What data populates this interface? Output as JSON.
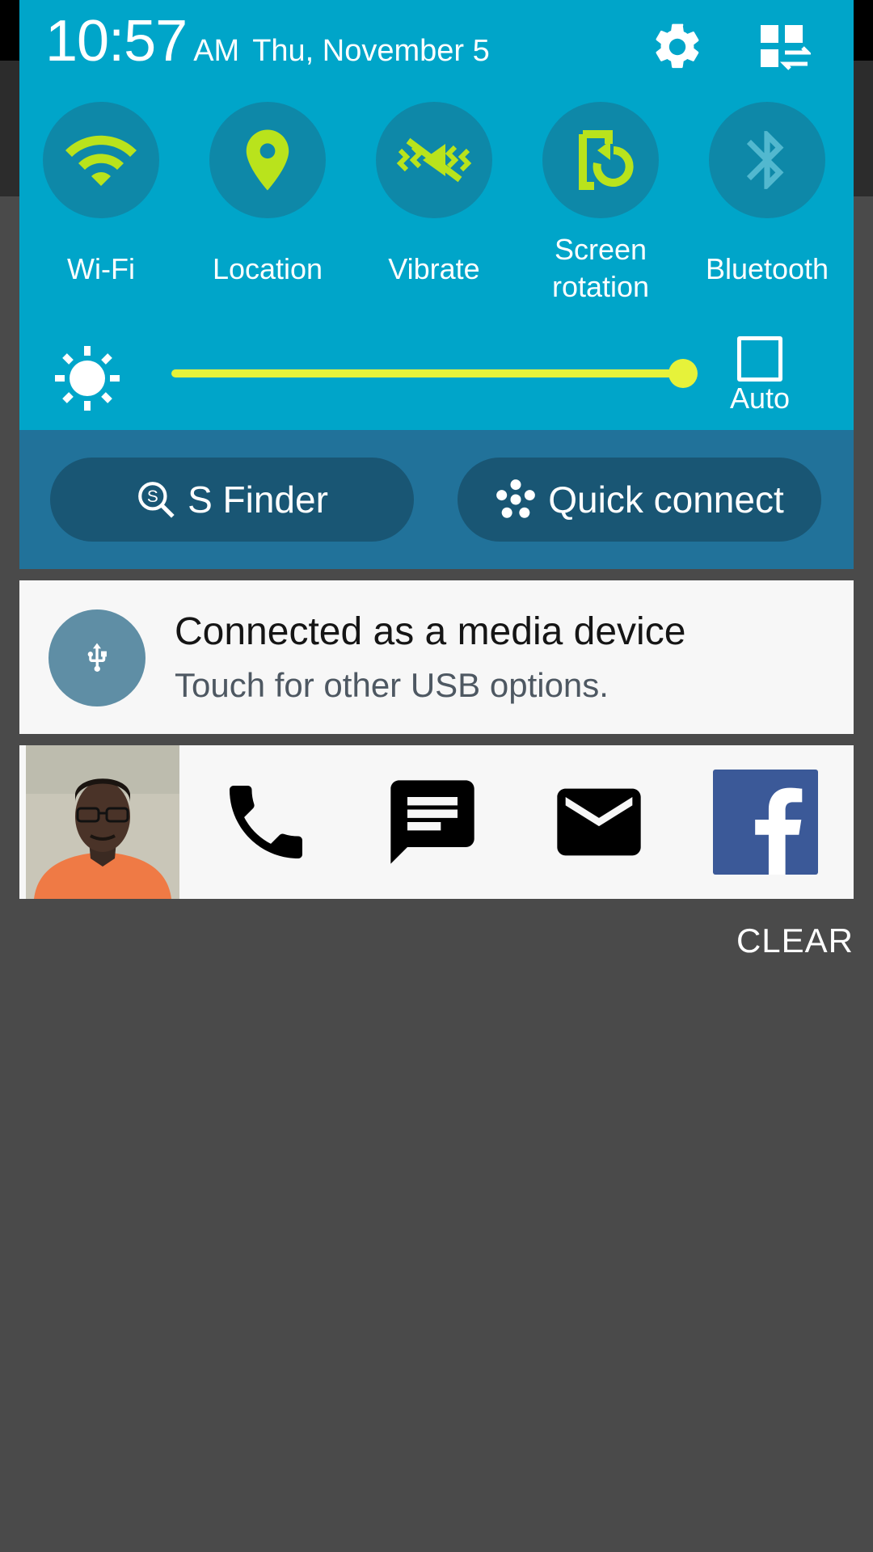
{
  "header": {
    "time": "10:57",
    "ampm": "AM",
    "date": "Thu, November 5",
    "settings_icon": "gear-icon",
    "edit_icon": "edit-toggles-icon"
  },
  "toggles": [
    {
      "label": "Wi-Fi",
      "icon": "wifi-icon",
      "active": true
    },
    {
      "label": "Location",
      "icon": "location-pin-icon",
      "active": true
    },
    {
      "label": "Vibrate",
      "icon": "vibrate-icon",
      "active": true
    },
    {
      "label_line1": "Screen",
      "label_line2": "rotation",
      "icon": "screen-rotation-icon",
      "active": true
    },
    {
      "label": "Bluetooth",
      "icon": "bluetooth-icon",
      "active": false
    }
  ],
  "brightness": {
    "level_percent": 100,
    "auto_label": "Auto",
    "auto_checked": false
  },
  "quick_buttons": {
    "s_finder": "S Finder",
    "quick_connect": "Quick connect"
  },
  "usb_notification": {
    "title": "Connected as a media device",
    "subtitle": "Touch for other USB options.",
    "icon": "usb-icon"
  },
  "contact_notification": {
    "actions": [
      "phone-icon",
      "message-icon",
      "email-icon",
      "facebook-icon"
    ]
  },
  "clear_label": "CLEAR",
  "colors": {
    "panel": "#00a5c9",
    "toggle_circle": "#0e88a8",
    "active_icon": "#b9e31c",
    "inactive_icon": "#52b8cf",
    "slider": "#e6f23a",
    "button_bar": "#21729a",
    "pill": "#195674",
    "facebook": "#3b5998"
  }
}
